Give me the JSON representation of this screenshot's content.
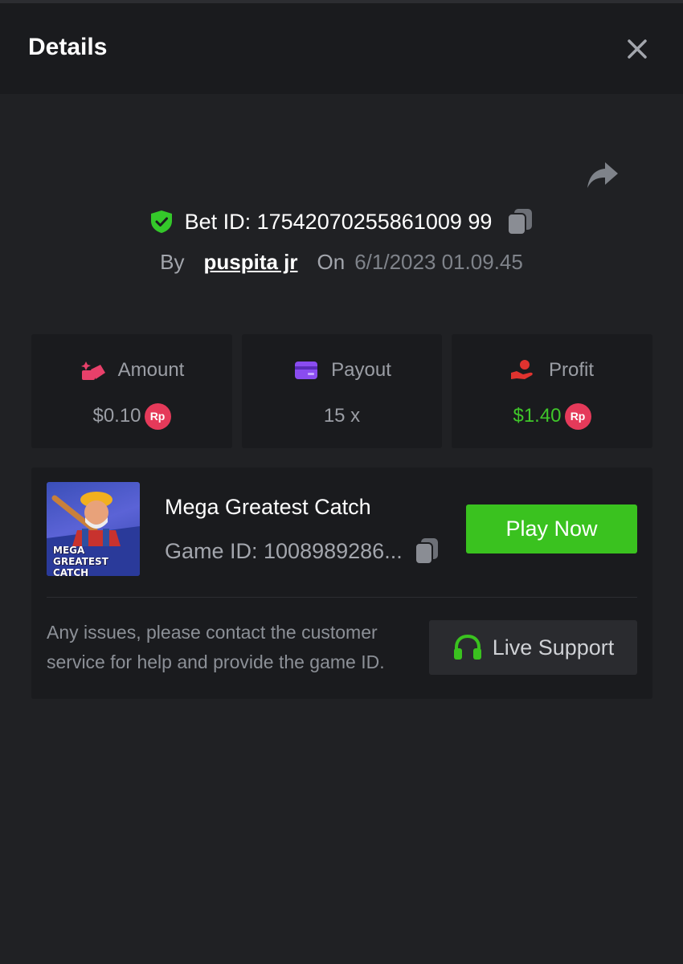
{
  "header": {
    "title": "Details"
  },
  "bet": {
    "id_label": "Bet ID: 17542070255861009 99",
    "by_label": "By",
    "user": "puspita jr",
    "on_label": "On",
    "date": "6/1/2023 01.09.45"
  },
  "stats": [
    {
      "label": "Amount",
      "value": "$0.10",
      "badge": "Rp",
      "icon": "amount-icon",
      "color": "#e8406a"
    },
    {
      "label": "Payout",
      "value": "15 x",
      "icon": "card-icon",
      "color": "#8a4cf0"
    },
    {
      "label": "Profit",
      "value": "$1.40",
      "badge": "Rp",
      "icon": "profit-icon",
      "color": "#e0332f"
    }
  ],
  "game": {
    "name": "Mega Greatest Catch",
    "id_label": "Game ID: 1008989286...",
    "thumb_title": "MEGA GREATEST CATCH",
    "play_label": "Play Now"
  },
  "support": {
    "help_text": "Any issues, please contact the customer service for help and provide the game ID.",
    "button_label": "Live Support"
  },
  "colors": {
    "accent_green": "#3ac21f",
    "profit_green": "#3fc62a",
    "badge_red": "#e53a5a",
    "shield_green": "#34c82a"
  }
}
